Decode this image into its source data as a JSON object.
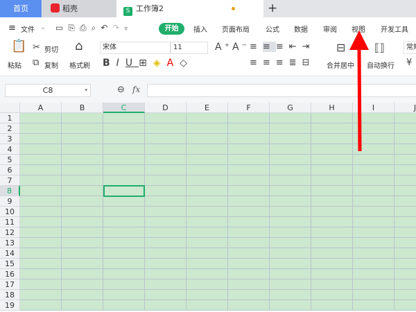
{
  "tabs": [
    {
      "label": "首页",
      "active": false
    },
    {
      "label": "稻壳",
      "active": false
    },
    {
      "label": "工作簿2",
      "active": true
    }
  ],
  "new_tab": "+",
  "menu": {
    "file": "文件",
    "items": [
      "开始",
      "插入",
      "页面布局",
      "公式",
      "数据",
      "审阅",
      "视图",
      "开发工具"
    ],
    "active": "开始"
  },
  "ribbon": {
    "paste": "粘贴",
    "cut": "剪切",
    "copy": "复制",
    "format_painter": "格式刷",
    "font": "宋体",
    "size": "11",
    "merge": "合并居中",
    "wrap": "自动换行",
    "number_format": "常规"
  },
  "formula_bar": {
    "cell_ref": "C8",
    "fx": "fx",
    "value": ""
  },
  "grid": {
    "columns": [
      "A",
      "B",
      "C",
      "D",
      "E",
      "F",
      "G",
      "H",
      "I",
      "J"
    ],
    "rows": [
      "1",
      "2",
      "3",
      "4",
      "5",
      "6",
      "7",
      "8",
      "9",
      "10",
      "11",
      "12",
      "13",
      "14",
      "15",
      "16",
      "17",
      "18",
      "19"
    ],
    "selected_cell": "C8",
    "selected_col": "C",
    "selected_row": "8"
  },
  "colors": {
    "accent": "#1fae6b",
    "cell_bg": "#cce8cf",
    "home_tab": "#5b8ff0",
    "arrow": "#ff0000"
  }
}
